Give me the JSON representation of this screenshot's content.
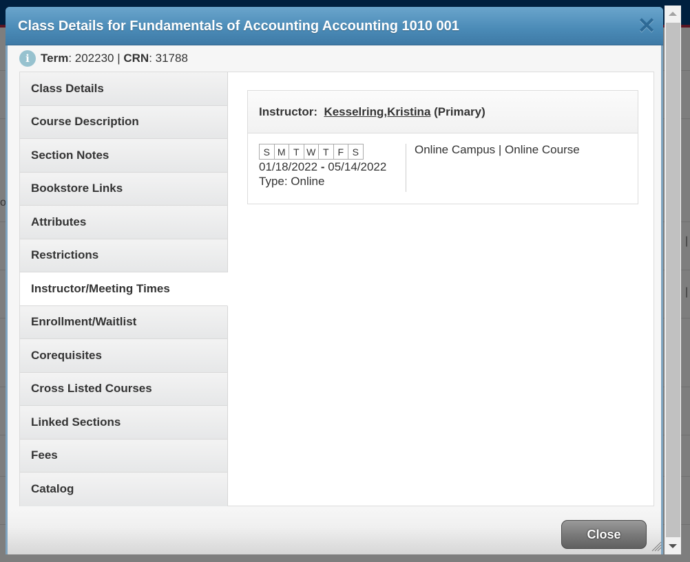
{
  "dialog": {
    "title": "Class Details for Fundamentals of Accounting Accounting 1010 001",
    "close_icon": "close-x-icon",
    "meta": {
      "info_icon": "info-icon",
      "term_label": "Term",
      "term_value": ": 202230 | ",
      "crn_label": "CRN",
      "crn_value": ": 31788"
    },
    "tabs": [
      {
        "label": "Class Details",
        "active": false
      },
      {
        "label": "Course Description",
        "active": false
      },
      {
        "label": "Section Notes",
        "active": false
      },
      {
        "label": "Bookstore Links",
        "active": false
      },
      {
        "label": "Attributes",
        "active": false
      },
      {
        "label": "Restrictions",
        "active": false
      },
      {
        "label": "Instructor/Meeting Times",
        "active": true
      },
      {
        "label": "Enrollment/Waitlist",
        "active": false
      },
      {
        "label": "Corequisites",
        "active": false
      },
      {
        "label": "Cross Listed Courses",
        "active": false
      },
      {
        "label": "Linked Sections",
        "active": false
      },
      {
        "label": "Fees",
        "active": false
      },
      {
        "label": "Catalog",
        "active": false
      }
    ],
    "instructor": {
      "label": "Instructor:",
      "name": "Kesselring,Kristina",
      "role": "(Primary)"
    },
    "meeting": {
      "days": [
        "S",
        "M",
        "T",
        "W",
        "T",
        "F",
        "S"
      ],
      "start_date": "01/18/2022",
      "date_separator": "-",
      "end_date": "05/14/2022",
      "type": "Type: Online",
      "location": "Online Campus | Online Course"
    },
    "close_button": "Close"
  },
  "background": {
    "fragments": [
      "or",
      "|",
      "|"
    ]
  }
}
